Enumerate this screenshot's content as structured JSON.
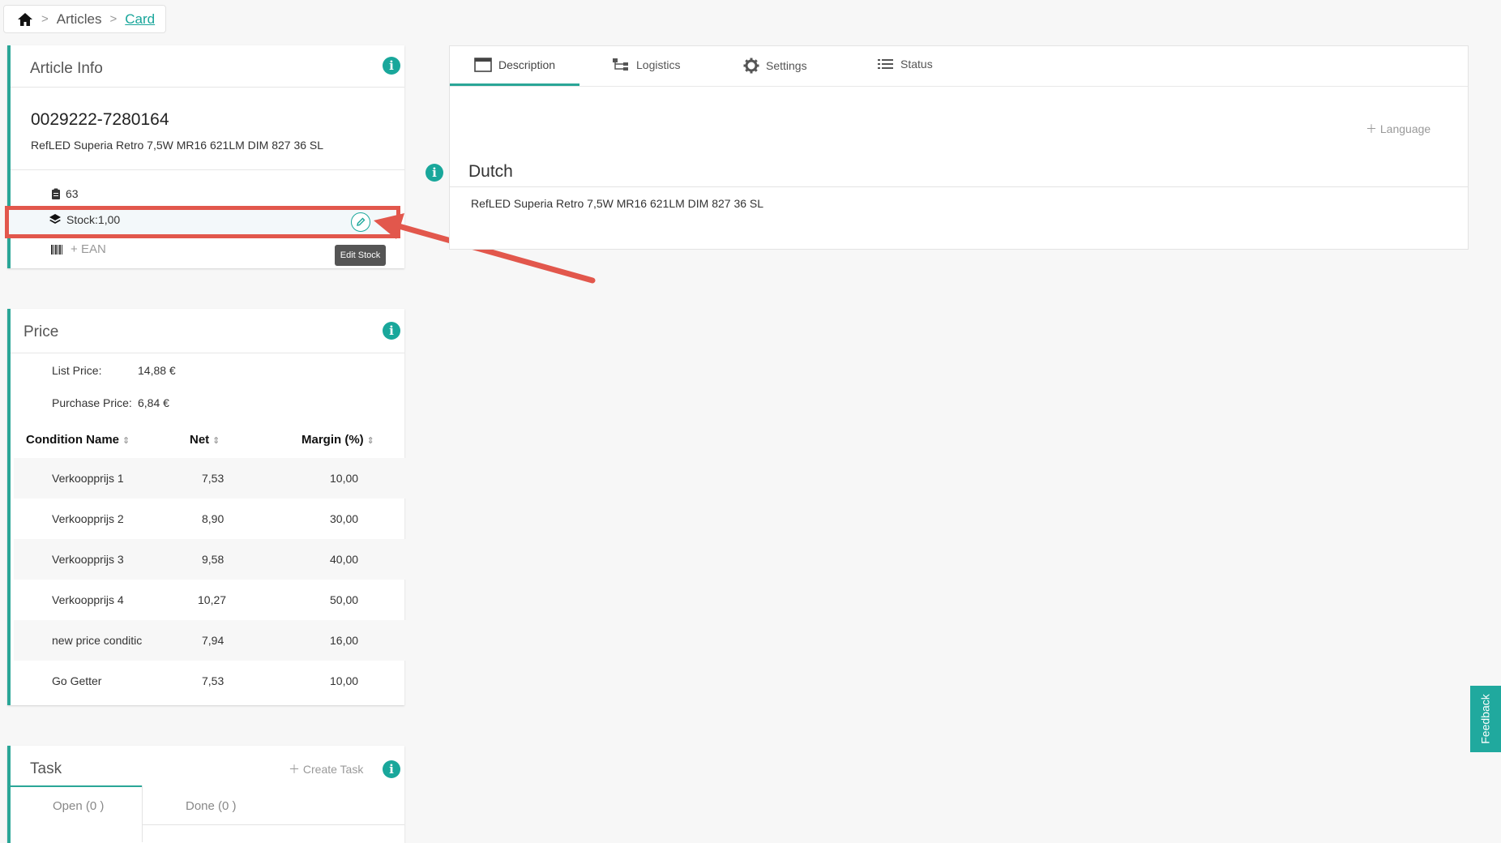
{
  "breadcrumb": {
    "items": [
      "Articles",
      "Card"
    ]
  },
  "article_info": {
    "title": "Article Info",
    "article_number": "0029222-7280164",
    "description": "RefLED Superia Retro 7,5W MR16 621LM DIM 827 36 SL",
    "count": "63",
    "stock": "Stock:1,00",
    "ean_label": "EAN",
    "tooltip": "Edit Stock"
  },
  "price": {
    "title": "Price",
    "list_price_label": "List Price:",
    "list_price_value": "14,88 €",
    "purchase_price_label": "Purchase Price:",
    "purchase_price_value": "6,84 €",
    "columns": [
      "Condition Name",
      "Net",
      "Margin (%)"
    ],
    "rows": [
      {
        "name": "Verkoopprijs 1",
        "net": "7,53",
        "margin": "10,00"
      },
      {
        "name": "Verkoopprijs 2",
        "net": "8,90",
        "margin": "30,00"
      },
      {
        "name": "Verkoopprijs 3",
        "net": "9,58",
        "margin": "40,00"
      },
      {
        "name": "Verkoopprijs 4",
        "net": "10,27",
        "margin": "50,00"
      },
      {
        "name": "new price conditic",
        "net": "7,94",
        "margin": "16,00"
      },
      {
        "name": "Go Getter",
        "net": "7,53",
        "margin": "10,00"
      }
    ]
  },
  "task": {
    "title": "Task",
    "create_label": "Create Task",
    "tabs": [
      "Open (0 )",
      "Done (0 )"
    ]
  },
  "description_panel": {
    "tabs": [
      "Description",
      "Logistics",
      "Settings",
      "Status"
    ],
    "language_button": "Language",
    "language_title": "Dutch",
    "language_text": "RefLED Superia Retro 7,5W MR16 621LM DIM 827 36 SL"
  },
  "feedback_label": "Feedback",
  "colors": {
    "accent": "#2aa697",
    "highlight": "#e2574c"
  }
}
